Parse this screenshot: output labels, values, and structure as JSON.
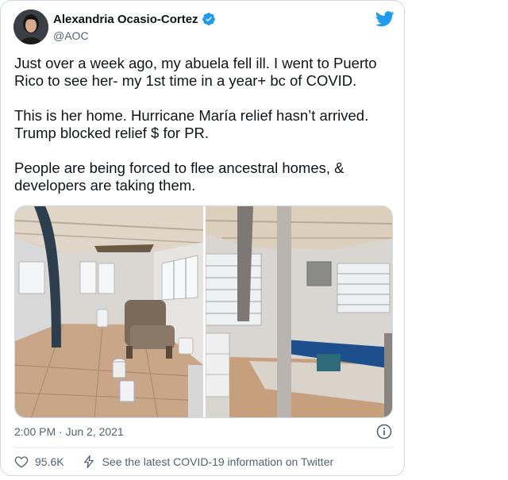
{
  "author": {
    "display_name": "Alexandria Ocasio-Cortez",
    "handle": "@AOC",
    "avatar_icon": "avatar-photo",
    "verified_icon": "verified-badge-icon"
  },
  "brand": {
    "icon": "twitter-bird-icon",
    "color": "#1d9bf0"
  },
  "tweet": {
    "text": "Just over a week ago, my abuela fell ill. I went to Puerto Rico to see her- my 1st time in a year+ bc of COVID.\n\nThis is her home. Hurricane María relief hasn’t arrived. Trump blocked relief $ for PR.\n\nPeople are being forced to flee ancestral homes, & developers are taking them.",
    "timestamp": "2:00 PM · Jun 2, 2021"
  },
  "media": {
    "photos": [
      "room-photo-left",
      "room-photo-right"
    ]
  },
  "actions": {
    "like_count": "95.6K",
    "covid_info": "See the latest COVID-19 information on Twitter"
  },
  "colors": {
    "text": "#0f1419",
    "secondary": "#536471",
    "border": "#cfd9de"
  }
}
